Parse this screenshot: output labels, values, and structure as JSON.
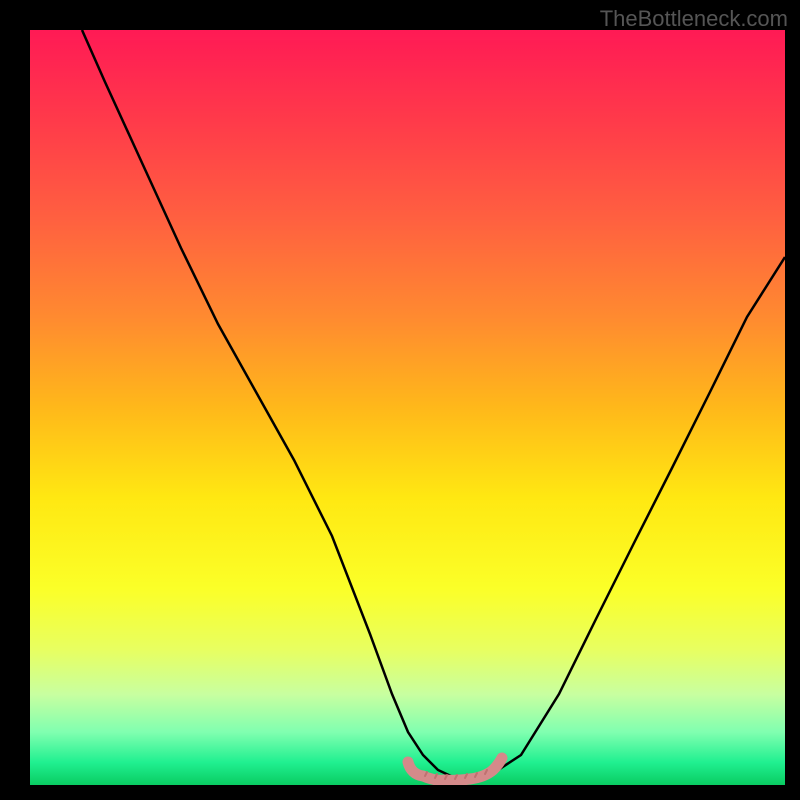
{
  "watermark": "TheBottleneck.com",
  "chart_data": {
    "type": "line",
    "title": "",
    "xlabel": "",
    "ylabel": "",
    "xlim": [
      0,
      100
    ],
    "ylim": [
      0,
      100
    ],
    "series": [
      {
        "name": "curve",
        "x": [
          7,
          10,
          15,
          20,
          25,
          30,
          35,
          40,
          45,
          48,
          50,
          52,
          54,
          56,
          58,
          60,
          62,
          65,
          70,
          75,
          80,
          85,
          90,
          95,
          100
        ],
        "y": [
          100,
          93,
          82,
          71,
          61,
          52,
          43,
          33,
          20,
          12,
          7,
          4,
          2,
          1,
          1,
          1,
          2,
          4,
          12,
          22,
          32,
          42,
          52,
          62,
          70
        ]
      },
      {
        "name": "bottom-marker",
        "x": [
          50,
          52,
          54,
          56,
          58,
          60,
          62
        ],
        "y": [
          3,
          2,
          1.5,
          1.5,
          1.5,
          1.8,
          3
        ]
      }
    ],
    "colors": {
      "curve": "#000000",
      "marker": "#d48a8a",
      "gradient_top": "#ff1a55",
      "gradient_bottom": "#0acc62"
    }
  }
}
